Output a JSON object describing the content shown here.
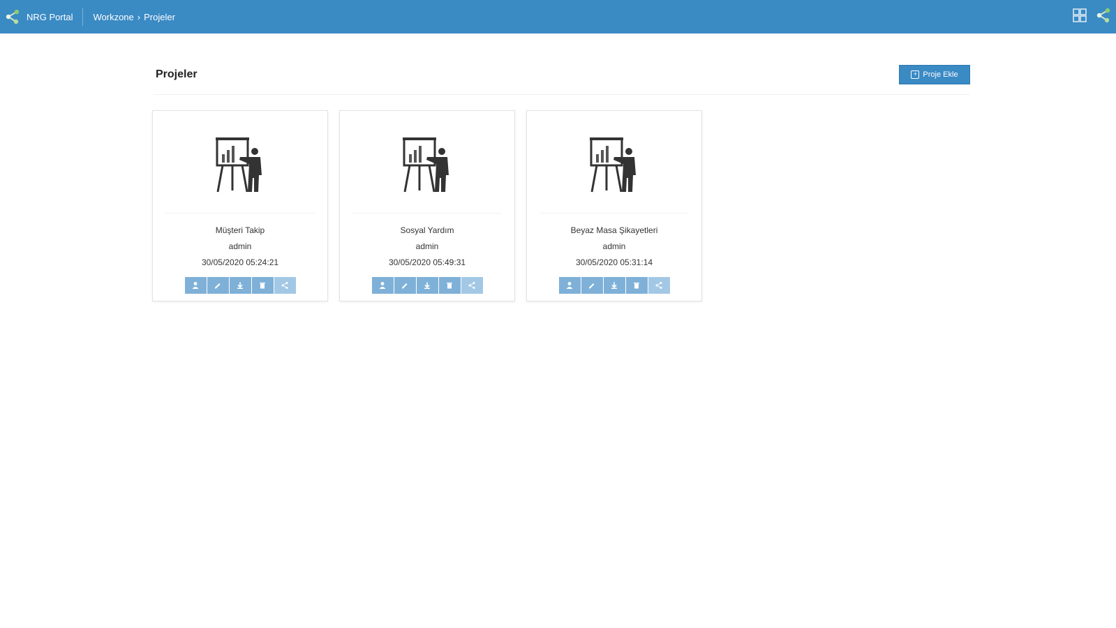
{
  "header": {
    "app_name": "NRG Portal",
    "breadcrumb": [
      "Workzone",
      "Projeler"
    ],
    "breadcrumb_separator": "›",
    "bg_color": "#3a8ac4",
    "logo_icon": "share-nodes-icon",
    "right_icons": [
      "grid-icon",
      "share-nodes-icon"
    ]
  },
  "page": {
    "title": "Projeler",
    "new_button_label": "Proje Ekle",
    "new_button_icon": "plus-square-icon"
  },
  "projects": [
    {
      "name": "Müşteri Takip",
      "owner": "admin",
      "date": "30/05/2020 05:24:21"
    },
    {
      "name": "Sosyal Yardım",
      "owner": "admin",
      "date": "30/05/2020 05:49:31"
    },
    {
      "name": "Beyaz Masa Şikayetleri",
      "owner": "admin",
      "date": "30/05/2020 05:31:14"
    }
  ],
  "card_icon": "presentation-board-icon",
  "card_actions": [
    "user-icon",
    "edit-icon",
    "download-icon",
    "trash-icon",
    "share-icon"
  ]
}
